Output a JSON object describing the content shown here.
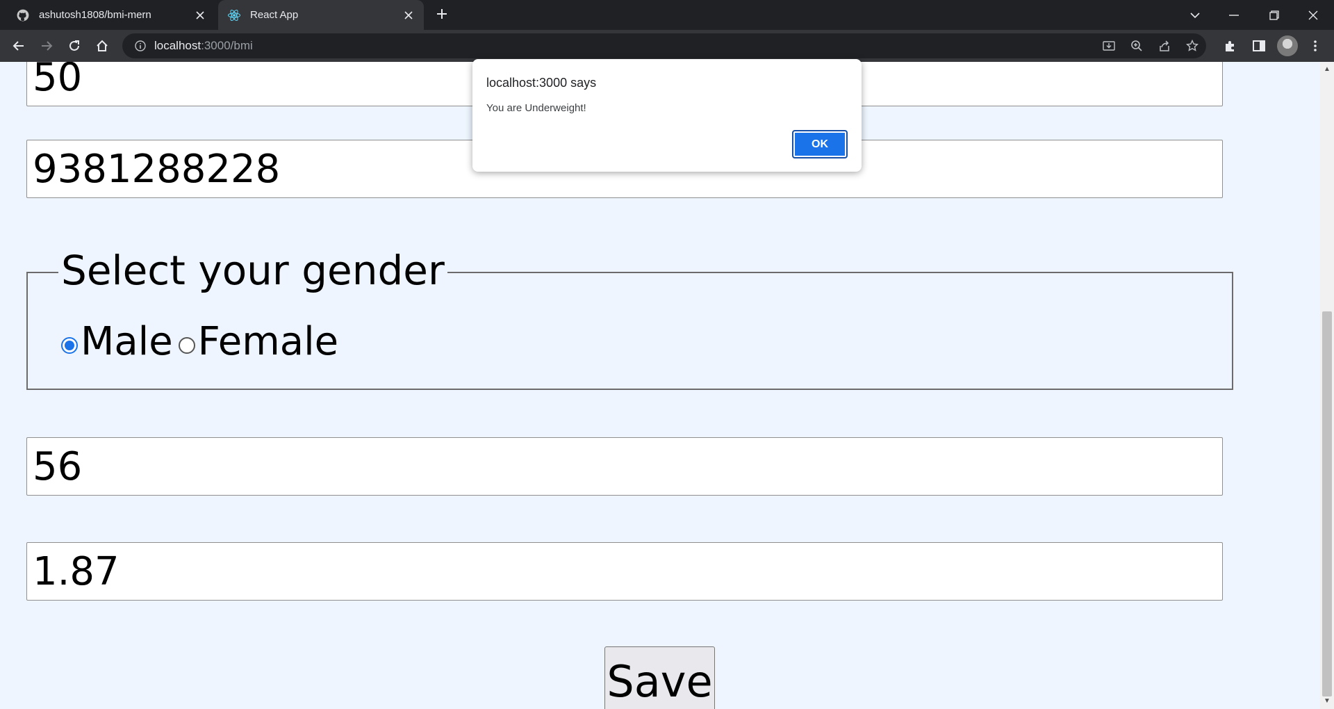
{
  "browser": {
    "tabs": [
      {
        "title": "ashutosh1808/bmi-mern",
        "favicon": "github-icon",
        "active": false
      },
      {
        "title": "React App",
        "favicon": "react-icon",
        "active": true
      }
    ],
    "url_host": "localhost",
    "url_path": ":3000/bmi"
  },
  "form": {
    "field_top_value": "50",
    "phone_value": "9381288228",
    "gender_legend": "Select your gender",
    "gender_options": [
      {
        "label": "Male",
        "checked": true
      },
      {
        "label": "Female",
        "checked": false
      }
    ],
    "weight_value": "56",
    "height_value": "1.87",
    "save_label": "Save"
  },
  "dialog": {
    "title": "localhost:3000 says",
    "message": "You are Underweight!",
    "ok_label": "OK"
  },
  "colors": {
    "page_background": "#eef5fe",
    "accent": "#1a73e8",
    "chrome_dark": "#202124",
    "chrome_toolbar": "#35363a"
  }
}
